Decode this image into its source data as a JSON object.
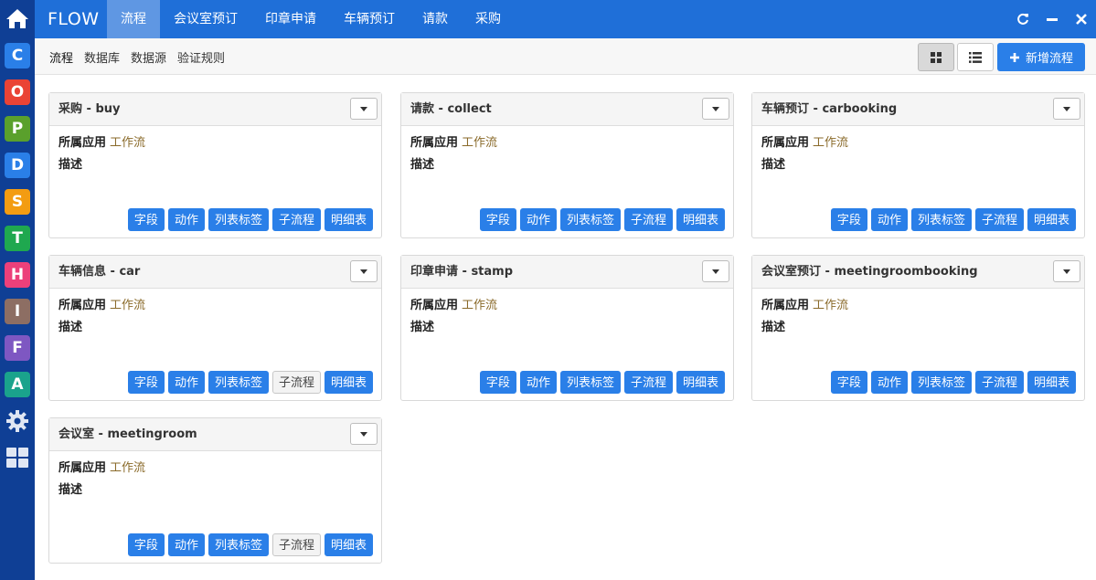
{
  "rail": {
    "apps": [
      {
        "icon": "home-icon",
        "letter": "",
        "color": ""
      },
      {
        "icon": "app-c-icon",
        "letter": "C",
        "color": "#2a7fe8"
      },
      {
        "icon": "app-o-icon",
        "letter": "O",
        "color": "#ea4335"
      },
      {
        "icon": "app-p-icon",
        "letter": "P",
        "color": "#5aa02c"
      },
      {
        "icon": "app-d-icon",
        "letter": "D",
        "color": "#2a7fe8"
      },
      {
        "icon": "app-s-icon",
        "letter": "S",
        "color": "#f39c12"
      },
      {
        "icon": "app-t-icon",
        "letter": "T",
        "color": "#1fa84f"
      },
      {
        "icon": "app-h-icon",
        "letter": "H",
        "color": "#ec407a"
      },
      {
        "icon": "app-i-icon",
        "letter": "I",
        "color": "#8d6e63"
      },
      {
        "icon": "app-f-icon",
        "letter": "F",
        "color": "#7e57c2"
      },
      {
        "icon": "app-a-icon",
        "letter": "A",
        "color": "#1aa38c"
      },
      {
        "icon": "gear-icon",
        "letter": "",
        "color": ""
      },
      {
        "icon": "grid-icon",
        "letter": "",
        "color": ""
      }
    ]
  },
  "topbar": {
    "brand": "FLOW",
    "nav": [
      "流程",
      "会议室预订",
      "印章申请",
      "车辆预订",
      "请款",
      "采购"
    ],
    "active_index": 0
  },
  "subbar": {
    "items": [
      "流程",
      "数据库",
      "数据源",
      "验证规则"
    ],
    "active_index": 0,
    "new_label": "新增流程"
  },
  "labels": {
    "app_label": "所属应用",
    "desc_label": "描述"
  },
  "cards": [
    {
      "title": "采购 - buy",
      "app": "工作流",
      "desc": "",
      "buttons": [
        {
          "label": "字段",
          "active": true
        },
        {
          "label": "动作",
          "active": true
        },
        {
          "label": "列表标签",
          "active": true
        },
        {
          "label": "子流程",
          "active": true
        },
        {
          "label": "明细表",
          "active": true
        }
      ]
    },
    {
      "title": "请款 - collect",
      "app": "工作流",
      "desc": "",
      "buttons": [
        {
          "label": "字段",
          "active": true
        },
        {
          "label": "动作",
          "active": true
        },
        {
          "label": "列表标签",
          "active": true
        },
        {
          "label": "子流程",
          "active": true
        },
        {
          "label": "明细表",
          "active": true
        }
      ]
    },
    {
      "title": "车辆预订 - carbooking",
      "app": "工作流",
      "desc": "",
      "buttons": [
        {
          "label": "字段",
          "active": true
        },
        {
          "label": "动作",
          "active": true
        },
        {
          "label": "列表标签",
          "active": true
        },
        {
          "label": "子流程",
          "active": true
        },
        {
          "label": "明细表",
          "active": true
        }
      ]
    },
    {
      "title": "车辆信息 - car",
      "app": "工作流",
      "desc": "",
      "buttons": [
        {
          "label": "字段",
          "active": true
        },
        {
          "label": "动作",
          "active": true
        },
        {
          "label": "列表标签",
          "active": true
        },
        {
          "label": "子流程",
          "active": false
        },
        {
          "label": "明细表",
          "active": true
        }
      ]
    },
    {
      "title": "印章申请 - stamp",
      "app": "工作流",
      "desc": "",
      "buttons": [
        {
          "label": "字段",
          "active": true
        },
        {
          "label": "动作",
          "active": true
        },
        {
          "label": "列表标签",
          "active": true
        },
        {
          "label": "子流程",
          "active": true
        },
        {
          "label": "明细表",
          "active": true
        }
      ]
    },
    {
      "title": "会议室预订 - meetingroombooking",
      "app": "工作流",
      "desc": "",
      "buttons": [
        {
          "label": "字段",
          "active": true
        },
        {
          "label": "动作",
          "active": true
        },
        {
          "label": "列表标签",
          "active": true
        },
        {
          "label": "子流程",
          "active": true
        },
        {
          "label": "明细表",
          "active": true
        }
      ]
    },
    {
      "title": "会议室 - meetingroom",
      "app": "工作流",
      "desc": "",
      "buttons": [
        {
          "label": "字段",
          "active": true
        },
        {
          "label": "动作",
          "active": true
        },
        {
          "label": "列表标签",
          "active": true
        },
        {
          "label": "子流程",
          "active": false
        },
        {
          "label": "明细表",
          "active": true
        }
      ]
    }
  ]
}
